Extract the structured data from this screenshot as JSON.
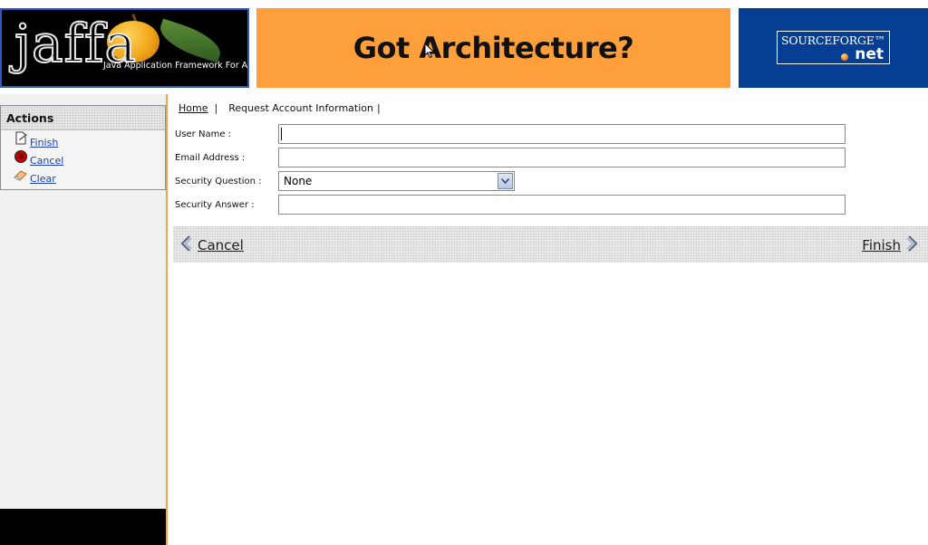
{
  "header": {
    "jaffa_logo": "jaffa",
    "jaffa_tagline": "Java Application Framework For All",
    "banner_headline": "Got Architecture?",
    "sourceforge_top": "SOURCEFORGE™",
    "sourceforge_bottom": "net",
    "colors": {
      "jaffa_border": "#2f57c8",
      "arch_bg": "#fd9f3a",
      "sf_bg": "#053e92"
    }
  },
  "sidebar": {
    "title": "Actions",
    "items": [
      {
        "label": "Finish",
        "icon": "finish-icon"
      },
      {
        "label": "Cancel",
        "icon": "cancel-icon"
      },
      {
        "label": "Clear",
        "icon": "eraser-icon"
      }
    ]
  },
  "breadcrumb": {
    "home": "Home",
    "current": "Request Account Information",
    "separator": "|"
  },
  "form": {
    "user_name_label": "User Name :",
    "user_name_value": "",
    "email_label": "Email Address :",
    "email_value": "",
    "question_label": "Security Question :",
    "question_selected": "None",
    "answer_label": "Security Answer :",
    "answer_value": ""
  },
  "nav": {
    "cancel_label": "Cancel",
    "finish_label": "Finish"
  }
}
